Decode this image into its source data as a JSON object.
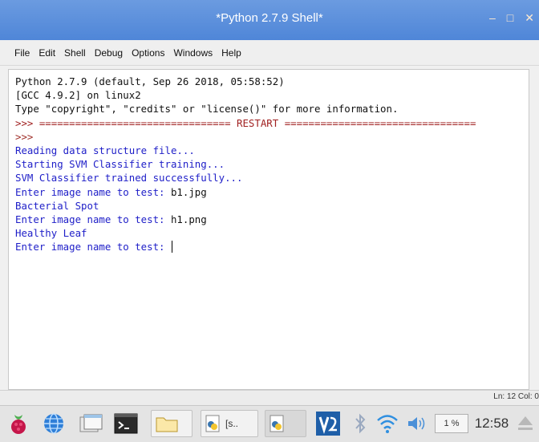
{
  "window": {
    "title": "*Python 2.7.9 Shell*",
    "controls": {
      "minimize": "–",
      "maximize": "□",
      "close": "✕"
    }
  },
  "menu": [
    "File",
    "Edit",
    "Shell",
    "Debug",
    "Options",
    "Windows",
    "Help"
  ],
  "shell": {
    "header": [
      "Python 2.7.9 (default, Sep 26 2018, 05:58:52)",
      "[GCC 4.9.2] on linux2",
      "Type \"copyright\", \"credits\" or \"license()\" for more information."
    ],
    "restart_line": ">>> ================================ RESTART ================================",
    "prompt": ">>>",
    "session": [
      {
        "text": "Reading data structure file...",
        "kind": "output"
      },
      {
        "text": "Starting SVM Classifier training...",
        "kind": "output"
      },
      {
        "text": "SVM Classifier trained successfully...",
        "kind": "output"
      },
      {
        "text": "Enter image name to test: ",
        "input": "b1.jpg",
        "kind": "input"
      },
      {
        "text": "Bacterial Spot",
        "kind": "output"
      },
      {
        "text": "Enter image name to test: ",
        "input": "h1.png",
        "kind": "input"
      },
      {
        "text": "Healthy Leaf",
        "kind": "output"
      },
      {
        "text": "Enter image name to test: ",
        "input": "",
        "kind": "input-active"
      }
    ]
  },
  "status_bar": {
    "position": "Ln: 12 Col: 0"
  },
  "taskbar": {
    "tasks": [
      {
        "label": "",
        "icon": "folder-icon"
      },
      {
        "label": "[s..",
        "icon": "python-file-icon"
      },
      {
        "label": "",
        "icon": "python-shell-icon"
      }
    ],
    "tray": {
      "cpu_percent": "1 %",
      "clock": "12:58"
    }
  }
}
